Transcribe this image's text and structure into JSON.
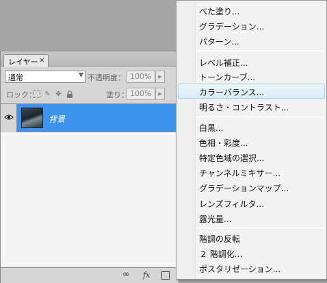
{
  "panel": {
    "tab_label": "レイヤー",
    "tab_close": "×",
    "blend_mode": "通常",
    "opacity_label": "不透明度：",
    "opacity_value": "100%",
    "lock_label": "ロック：",
    "fill_label": "塗り：",
    "fill_value": "100%",
    "layer_name": "背景",
    "link_icon_glyph": "∞",
    "fx_label": "fx"
  },
  "menu": {
    "items": [
      "べた塗り...",
      "グラデーション...",
      "パターン...",
      "レベル補正...",
      "トーンカーブ...",
      "カラーバランス...",
      "明るさ・コントラスト...",
      "白黒...",
      "色相・彩度...",
      "特定色域の選択...",
      "チャンネルミキサー...",
      "グラデーションマップ...",
      "レンズフィルタ...",
      "露光量...",
      "階調の反転",
      "２ 階調化...",
      "ポスタリゼーション..."
    ],
    "highlighted": "カラーバランス..."
  },
  "colors": {
    "selected_layer": "#3e93ef",
    "menu_highlight": "#dbecf8",
    "background": "#a6a6a6"
  }
}
